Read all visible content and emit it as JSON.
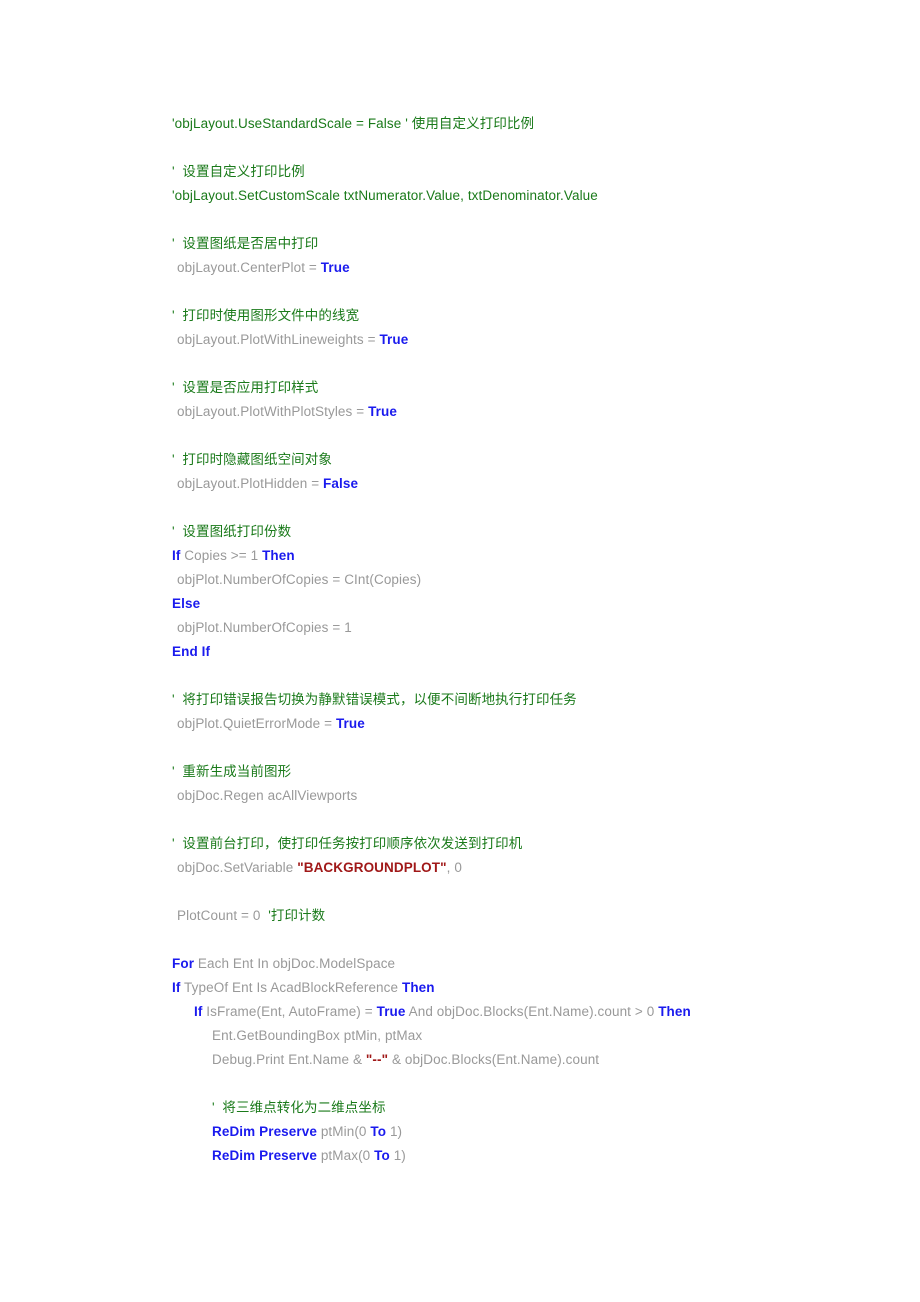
{
  "document": {
    "kind": "vba-code-listing",
    "language": "VBA",
    "background_color": "#ffffff"
  },
  "colors": {
    "comment": "#1a7a1a",
    "code": "#999999",
    "keyword": "#1a1aee",
    "function": "#3a7a9a",
    "string": "#a01818",
    "print_keyword": "#ff8800",
    "property": "#1a1aee"
  },
  "lines": [
    {
      "id": "l1",
      "indent": "ind-0",
      "tokens": [
        {
          "t": "'objLayout.UseStandardScale = False ' 使用自定义打印比例",
          "c": "comment"
        }
      ]
    },
    {
      "id": "l2",
      "indent": "ind-0",
      "tokens": []
    },
    {
      "id": "l3",
      "indent": "ind-0",
      "tokens": [
        {
          "t": "'  设置自定义打印比例",
          "c": "comment"
        }
      ]
    },
    {
      "id": "l4",
      "indent": "ind-0",
      "tokens": [
        {
          "t": "'objLayout.SetCustomScale txtNumerator.Value, txtDenominator.Value",
          "c": "comment"
        }
      ]
    },
    {
      "id": "l5",
      "indent": "ind-0",
      "tokens": []
    },
    {
      "id": "l6",
      "indent": "ind-0",
      "tokens": [
        {
          "t": "'  设置图纸是否居中打印",
          "c": "comment"
        }
      ]
    },
    {
      "id": "l7",
      "indent": "ind-s",
      "tokens": [
        {
          "t": "objLayout.CenterPlot = ",
          "c": "code"
        },
        {
          "t": "True",
          "c": "keyword"
        }
      ]
    },
    {
      "id": "l8",
      "indent": "ind-0",
      "tokens": []
    },
    {
      "id": "l9",
      "indent": "ind-0",
      "tokens": [
        {
          "t": "'  打印时使用图形文件中的线宽",
          "c": "comment"
        }
      ]
    },
    {
      "id": "l10",
      "indent": "ind-s",
      "tokens": [
        {
          "t": "objLayout.PlotWithLineweights = ",
          "c": "code"
        },
        {
          "t": "True",
          "c": "keyword"
        }
      ]
    },
    {
      "id": "l11",
      "indent": "ind-0",
      "tokens": []
    },
    {
      "id": "l12",
      "indent": "ind-0",
      "tokens": [
        {
          "t": "'  设置是否应用打印样式",
          "c": "comment"
        }
      ]
    },
    {
      "id": "l13",
      "indent": "ind-s",
      "tokens": [
        {
          "t": "objLayout.PlotWithPlotStyles = ",
          "c": "code"
        },
        {
          "t": "True",
          "c": "keyword"
        }
      ]
    },
    {
      "id": "l14",
      "indent": "ind-0",
      "tokens": []
    },
    {
      "id": "l15",
      "indent": "ind-0",
      "tokens": [
        {
          "t": "'  打印时隐藏图纸空间对象",
          "c": "comment"
        }
      ]
    },
    {
      "id": "l16",
      "indent": "ind-s",
      "tokens": [
        {
          "t": "objLayout.PlotHidden = ",
          "c": "code"
        },
        {
          "t": "False",
          "c": "keyword"
        }
      ]
    },
    {
      "id": "l17",
      "indent": "ind-0",
      "tokens": []
    },
    {
      "id": "l18",
      "indent": "ind-0",
      "tokens": [
        {
          "t": "'  设置图纸打印份数",
          "c": "comment"
        }
      ]
    },
    {
      "id": "l19",
      "indent": "ind-0",
      "tokens": [
        {
          "t": "If",
          "c": "keyword"
        },
        {
          "t": " Copies >= 1 ",
          "c": "code"
        },
        {
          "t": "Then",
          "c": "keyword"
        }
      ]
    },
    {
      "id": "l20",
      "indent": "ind-s",
      "tokens": [
        {
          "t": "objPlot.NumberOfCopies = ",
          "c": "code"
        },
        {
          "t": "CInt",
          "c": "function"
        },
        {
          "t": "(Copies)",
          "c": "code"
        }
      ]
    },
    {
      "id": "l21",
      "indent": "ind-0",
      "tokens": [
        {
          "t": "Else",
          "c": "keyword"
        }
      ]
    },
    {
      "id": "l22",
      "indent": "ind-s",
      "tokens": [
        {
          "t": "objPlot.NumberOfCopies = 1",
          "c": "code"
        }
      ]
    },
    {
      "id": "l23",
      "indent": "ind-0",
      "tokens": [
        {
          "t": "End If",
          "c": "keyword"
        }
      ]
    },
    {
      "id": "l24",
      "indent": "ind-0",
      "tokens": []
    },
    {
      "id": "l25",
      "indent": "ind-0",
      "tokens": [
        {
          "t": "'  将打印错误报告切换为静默错误模式，以便不间断地执行打印任务",
          "c": "comment"
        }
      ]
    },
    {
      "id": "l26",
      "indent": "ind-s",
      "tokens": [
        {
          "t": "objPlot.QuietErrorMode = ",
          "c": "code"
        },
        {
          "t": "True",
          "c": "keyword"
        }
      ]
    },
    {
      "id": "l27",
      "indent": "ind-0",
      "tokens": []
    },
    {
      "id": "l28",
      "indent": "ind-0",
      "tokens": [
        {
          "t": "'  重新生成当前图形",
          "c": "comment"
        }
      ]
    },
    {
      "id": "l29",
      "indent": "ind-s",
      "tokens": [
        {
          "t": "objDoc.Regen acAllViewports",
          "c": "code"
        }
      ]
    },
    {
      "id": "l30",
      "indent": "ind-0",
      "tokens": []
    },
    {
      "id": "l31",
      "indent": "ind-0",
      "tokens": [
        {
          "t": "'  设置前台打印，使打印任务按打印顺序依次发送到打印机",
          "c": "comment"
        }
      ]
    },
    {
      "id": "l32",
      "indent": "ind-s",
      "tokens": [
        {
          "t": "objDoc.SetVariable ",
          "c": "code"
        },
        {
          "t": "\"BACKGROUNDPLOT\"",
          "c": "string"
        },
        {
          "t": ", 0",
          "c": "code"
        }
      ]
    },
    {
      "id": "l33",
      "indent": "ind-0",
      "tokens": []
    },
    {
      "id": "l34",
      "indent": "ind-s",
      "tokens": [
        {
          "t": "PlotCount = 0  ",
          "c": "code"
        },
        {
          "t": "'打印计数",
          "c": "comment"
        }
      ]
    },
    {
      "id": "l35",
      "indent": "ind-0",
      "tokens": []
    },
    {
      "id": "l36",
      "indent": "ind-0",
      "tokens": [
        {
          "t": "For",
          "c": "keyword"
        },
        {
          "t": " Each Ent In objDoc.ModelSpace",
          "c": "code"
        }
      ]
    },
    {
      "id": "l37",
      "indent": "ind-0",
      "tokens": [
        {
          "t": "If",
          "c": "keyword"
        },
        {
          "t": " TypeOf Ent Is AcadBlockReference ",
          "c": "code"
        },
        {
          "t": "Then",
          "c": "keyword"
        }
      ]
    },
    {
      "id": "l38",
      "indent": "ind-1",
      "tokens": [
        {
          "t": "If",
          "c": "keyword"
        },
        {
          "t": " IsFrame(Ent, AutoFrame) = ",
          "c": "code"
        },
        {
          "t": "True",
          "c": "keyword"
        },
        {
          "t": " And objDoc.Blocks(Ent.",
          "c": "code"
        },
        {
          "t": "Name",
          "c": "property"
        },
        {
          "t": ").count > 0 ",
          "c": "code"
        },
        {
          "t": "Then",
          "c": "keyword"
        }
      ]
    },
    {
      "id": "l39",
      "indent": "ind-2",
      "tokens": [
        {
          "t": "Ent.GetBoundingBox ptMin, ptMax",
          "c": "code"
        }
      ]
    },
    {
      "id": "l40",
      "indent": "ind-2",
      "tokens": [
        {
          "t": "Debug.",
          "c": "code"
        },
        {
          "t": "Print",
          "c": "print_keyword"
        },
        {
          "t": " Ent.",
          "c": "code"
        },
        {
          "t": "Name",
          "c": "property"
        },
        {
          "t": " & ",
          "c": "code"
        },
        {
          "t": "\"--\"",
          "c": "string"
        },
        {
          "t": " & objDoc.Blocks(Ent.",
          "c": "code"
        },
        {
          "t": "Name",
          "c": "property"
        },
        {
          "t": ").count",
          "c": "code"
        }
      ]
    },
    {
      "id": "l41",
      "indent": "ind-0",
      "tokens": []
    },
    {
      "id": "l42",
      "indent": "ind-2",
      "tokens": [
        {
          "t": "'  将三维点转化为二维点坐标",
          "c": "comment"
        }
      ]
    },
    {
      "id": "l43",
      "indent": "ind-2",
      "tokens": [
        {
          "t": "ReDim Preserve",
          "c": "keyword"
        },
        {
          "t": " ptMin(0 ",
          "c": "code"
        },
        {
          "t": "To",
          "c": "keyword"
        },
        {
          "t": " 1)",
          "c": "code"
        }
      ]
    },
    {
      "id": "l44",
      "indent": "ind-2",
      "tokens": [
        {
          "t": "ReDim Preserve",
          "c": "keyword"
        },
        {
          "t": " ptMax(0 ",
          "c": "code"
        },
        {
          "t": "To",
          "c": "keyword"
        },
        {
          "t": " 1)",
          "c": "code"
        }
      ]
    }
  ]
}
